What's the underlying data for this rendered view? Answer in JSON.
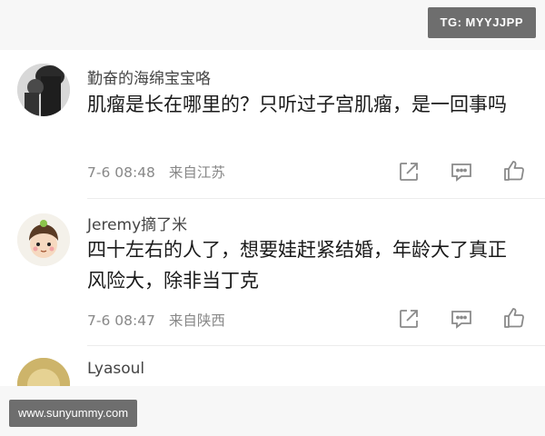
{
  "watermarks": {
    "telegram": "TG: MYYJJPP",
    "site": "www.sunyummy.com"
  },
  "comments": [
    {
      "username": "勤奋的海绵宝宝咯",
      "text": "肌瘤是长在哪里的？只听过子宫肌瘤，是一回事吗",
      "time": "7-6 08:48",
      "location": "来自江苏",
      "actions": [
        "share-icon",
        "comment-icon",
        "like-icon"
      ]
    },
    {
      "username": "Jeremy摘了米",
      "text": "四十左右的人了，想要娃赶紧结婚，年龄大了真正风险大，除非当丁克",
      "time": "7-6 08:47",
      "location": "来自陕西",
      "actions": [
        "share-icon",
        "comment-icon",
        "like-icon"
      ]
    },
    {
      "username": "Lyasoul"
    }
  ],
  "colors": {
    "text": "#1a1a1a",
    "meta": "#888888",
    "icon": "#8a8a8a",
    "watermark_bg": "#6e6e6e"
  }
}
